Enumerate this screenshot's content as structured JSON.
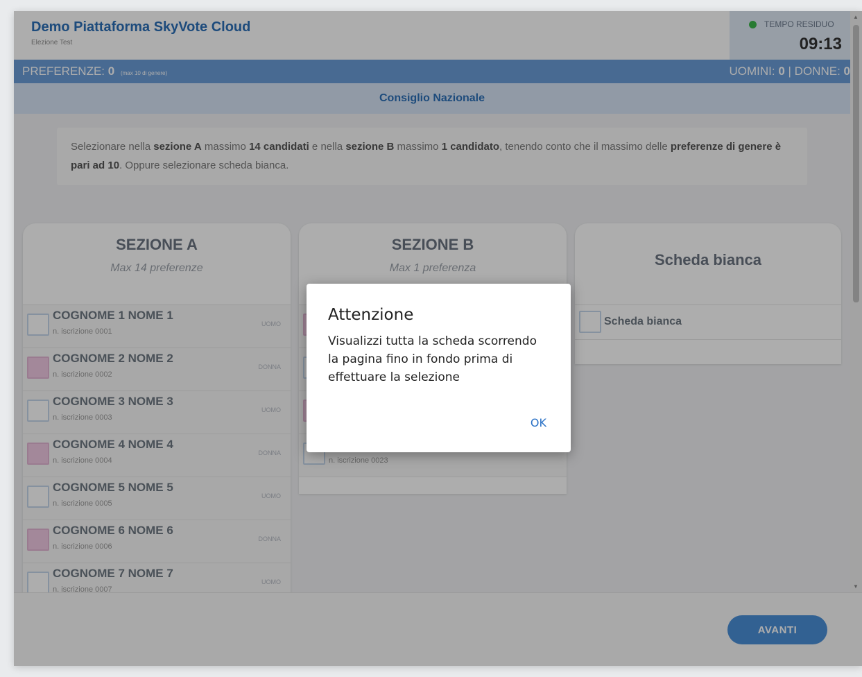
{
  "header": {
    "title": "Demo Piattaforma SkyVote Cloud",
    "subtitle": "Elezione Test",
    "timer_label": "TEMPO RESIDUO",
    "timer_value": "09:13"
  },
  "prefbar": {
    "label": "PREFERENZE:",
    "count": "0",
    "note": "(max 10 di genere)",
    "uomini_label": "UOMINI:",
    "uomini": "0",
    "separator": "|",
    "donne_label": "DONNE:",
    "donne": "0"
  },
  "section_title": "Consiglio Nazionale",
  "instructions": {
    "t1": "Selezionare nella ",
    "b1": "sezione A",
    "t2": " massimo ",
    "b2": "14 candidati",
    "t3": " e nella ",
    "b3": "sezione B",
    "t4": " massimo ",
    "b4": "1 candidato",
    "t5": ", tenendo conto che il massimo delle ",
    "b5": "preferenze di genere è pari ad 10",
    "t6": ". Oppure selezionare scheda bianca."
  },
  "sezione_a": {
    "title": "SEZIONE A",
    "subtitle": "Max 14 preferenze",
    "candidates": [
      {
        "name": "COGNOME 1 NOME 1",
        "number": "n. iscrizione 0001",
        "gender": "UOMO"
      },
      {
        "name": "COGNOME 2 NOME 2",
        "number": "n. iscrizione 0002",
        "gender": "DONNA"
      },
      {
        "name": "COGNOME 3 NOME 3",
        "number": "n. iscrizione 0003",
        "gender": "UOMO"
      },
      {
        "name": "COGNOME 4 NOME 4",
        "number": "n. iscrizione 0004",
        "gender": "DONNA"
      },
      {
        "name": "COGNOME 5 NOME 5",
        "number": "n. iscrizione 0005",
        "gender": "UOMO"
      },
      {
        "name": "COGNOME 6 NOME 6",
        "number": "n. iscrizione 0006",
        "gender": "DONNA"
      },
      {
        "name": "COGNOME 7 NOME 7",
        "number": "n. iscrizione 0007",
        "gender": "UOMO"
      }
    ]
  },
  "sezione_b": {
    "title": "SEZIONE B",
    "subtitle": "Max 1 preferenza",
    "last_number": "n. iscrizione 0023"
  },
  "scheda_bianca": {
    "title": "Scheda bianca",
    "option": "Scheda bianca"
  },
  "footer": {
    "avanti": "AVANTI"
  },
  "modal": {
    "title": "Attenzione",
    "text": "Visualizzi tutta la scheda scorrendo la pagina fino in fondo prima di effettuare la selezione",
    "ok": "OK"
  },
  "colors": {
    "brand": "#2c6fb7",
    "prefbar": "#6a9cd8",
    "female": "#f1c9e3",
    "status": "#3cb54a"
  }
}
